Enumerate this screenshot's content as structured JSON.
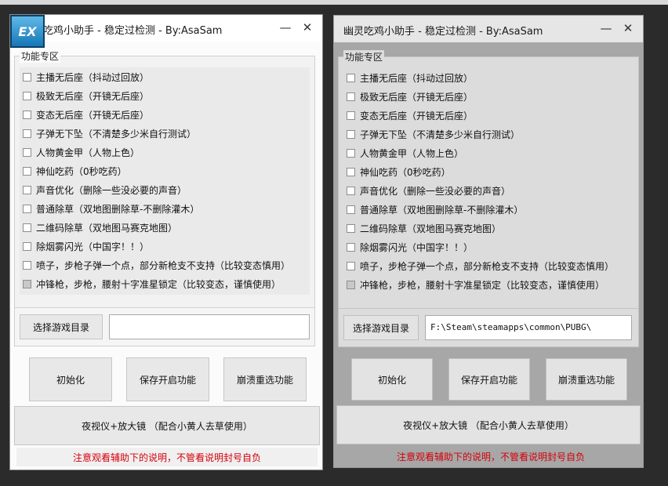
{
  "window_left": {
    "title": "吃鸡小助手 - 稳定过检测 - By:AsaSam",
    "logo_text": "EX",
    "minimize": "—",
    "close": "✕",
    "group_label": "功能专区",
    "items": [
      "主播无后座（抖动过回放）",
      "极致无后座（开镜无后座）",
      "变态无后座（开镜无后座）",
      "子弹无下坠（不清楚多少米自行测试）",
      "人物黄金甲（人物上色）",
      "神仙吃药（0秒吃药）",
      "声音优化（删除一些没必要的声音）",
      "普通除草（双地图删除草-不删除灌木）",
      "二维码除草（双地图马赛克地图）",
      "除烟雾闪光（中国字！！）",
      "喷子，步枪子弹一个点，部分新枪支不支持（比较变态慎用）",
      "冲锋枪，步枪，腰射十字准星锁定（比较变态，谨慎使用）"
    ],
    "select_dir_label": "选择游戏目录",
    "dir_value": "",
    "btn_init": "初始化",
    "btn_save": "保存开启功能",
    "btn_crash": "崩溃重选功能",
    "btn_night": "夜视仪+放大镜 （配合小黄人去草使用）",
    "warning": "注意观看辅助下的说明，不管看说明封号自负"
  },
  "window_right": {
    "title": "幽灵吃鸡小助手 - 稳定过检测 - By:AsaSam",
    "minimize": "—",
    "close": "✕",
    "group_label": "功能专区",
    "items": [
      "主播无后座（抖动过回放）",
      "极致无后座（开镜无后座）",
      "变态无后座（开镜无后座）",
      "子弹无下坠（不清楚多少米自行测试）",
      "人物黄金甲（人物上色）",
      "神仙吃药（0秒吃药）",
      "声音优化（删除一些没必要的声音）",
      "普通除草（双地图删除草-不删除灌木）",
      "二维码除草（双地图马赛克地图）",
      "除烟雾闪光（中国字！！）",
      "喷子，步枪子弹一个点，部分新枪支不支持（比较变态慎用）",
      "冲锋枪，步枪，腰射十字准星锁定（比较变态，谨慎使用）"
    ],
    "select_dir_label": "选择游戏目录",
    "dir_value": "F:\\Steam\\steamapps\\common\\PUBG\\",
    "btn_init": "初始化",
    "btn_save": "保存开启功能",
    "btn_crash": "崩溃重选功能",
    "btn_night": "夜视仪+放大镜 （配合小黄人去草使用）",
    "warning": "注意观看辅助下的说明，不管看说明封号自负"
  },
  "colors": {
    "warning": "#d4000a",
    "logo": "#1f8fd6"
  }
}
